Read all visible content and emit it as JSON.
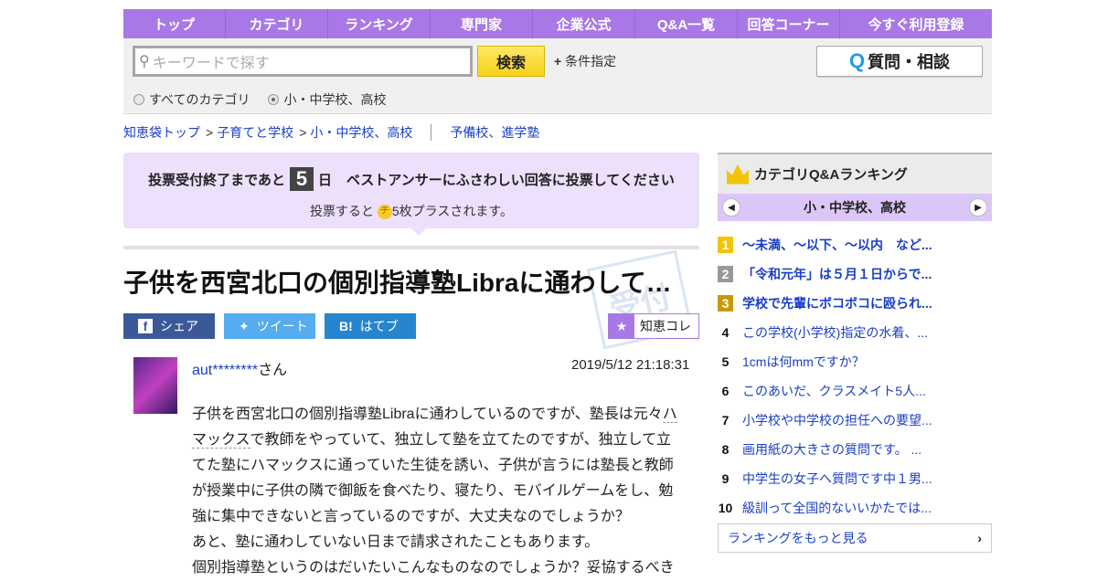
{
  "nav": [
    "トップ",
    "カテゴリ",
    "ランキング",
    "専門家",
    "企業公式",
    "Q&A一覧",
    "回答コーナー",
    "今すぐ利用登録"
  ],
  "search": {
    "placeholder": "キーワードで探す",
    "button": "検索",
    "condition": "条件指定",
    "ask_button": "質問・相談",
    "radios": [
      {
        "label": "すべてのカテゴリ",
        "checked": false
      },
      {
        "label": "小・中学校、高校",
        "checked": true
      }
    ]
  },
  "breadcrumb": [
    "知恵袋トップ",
    "子育てと学校",
    "小・中学校、高校"
  ],
  "breadcrumb_related": "予備校、進学塾",
  "vote": {
    "prefix": "投票受付終了まであと",
    "days": "5",
    "day_unit": "日",
    "message": "ベストアンサーにふさわしい回答に投票してください",
    "bonus_prefix": "投票すると",
    "coin": "チ",
    "bonus_suffix": "5枚プラスされます。"
  },
  "question": {
    "title": "子供を西宮北口の個別指導塾Libraに通わして…",
    "stamp": "受付",
    "user": "aut********",
    "user_suffix": "さん",
    "date": "2019/5/12  21:18:31",
    "body_before": "子供を西宮北口の個別指導塾Libraに通わしているのですが、塾長は元々",
    "body_link": "ハマックス",
    "body_after": "で教師をやっていて、独立して塾を立てたのですが、独立して立てた塾にハマックスに通っていた生徒を誘い、子供が言うには塾長と教師が授業中に子供の隣で御飯を食べたり、寝たり、モバイルゲームをし、勉強に集中できないと言っているのですが、大丈夫なのでしょうか？",
    "body_lines": [
      "あと、塾に通わしていない日まで請求されたこともあります。",
      "個別指導塾というのはだいたいこんなものなのでしょうか？妥協するべき"
    ]
  },
  "share": {
    "facebook": "シェア",
    "twitter": "ツイート",
    "hatena": "はてブ",
    "chiecolle": "知恵コレ"
  },
  "ranking": {
    "title": "カテゴリQ&Aランキング",
    "category": "小・中学校、高校",
    "more": "ランキングをもっと見る",
    "items": [
      {
        "n": "1",
        "t": "～未満、～以下、～以内　など..."
      },
      {
        "n": "2",
        "t": "「令和元年」は５月１日からで..."
      },
      {
        "n": "3",
        "t": "学校で先輩にボコボコに殴られ..."
      },
      {
        "n": "4",
        "t": "この学校(小学校)指定の水着、..."
      },
      {
        "n": "5",
        "t": "1cmは何mmですか？"
      },
      {
        "n": "6",
        "t": "このあいだ、クラスメイト5人..."
      },
      {
        "n": "7",
        "t": "小学校や中学校の担任への要望..."
      },
      {
        "n": "8",
        "t": "画用紙の大きさの質問です。 ..."
      },
      {
        "n": "9",
        "t": "中学生の女子へ質問です中１男..."
      },
      {
        "n": "10",
        "t": "級訓って全国的ないいかたでは..."
      }
    ]
  }
}
